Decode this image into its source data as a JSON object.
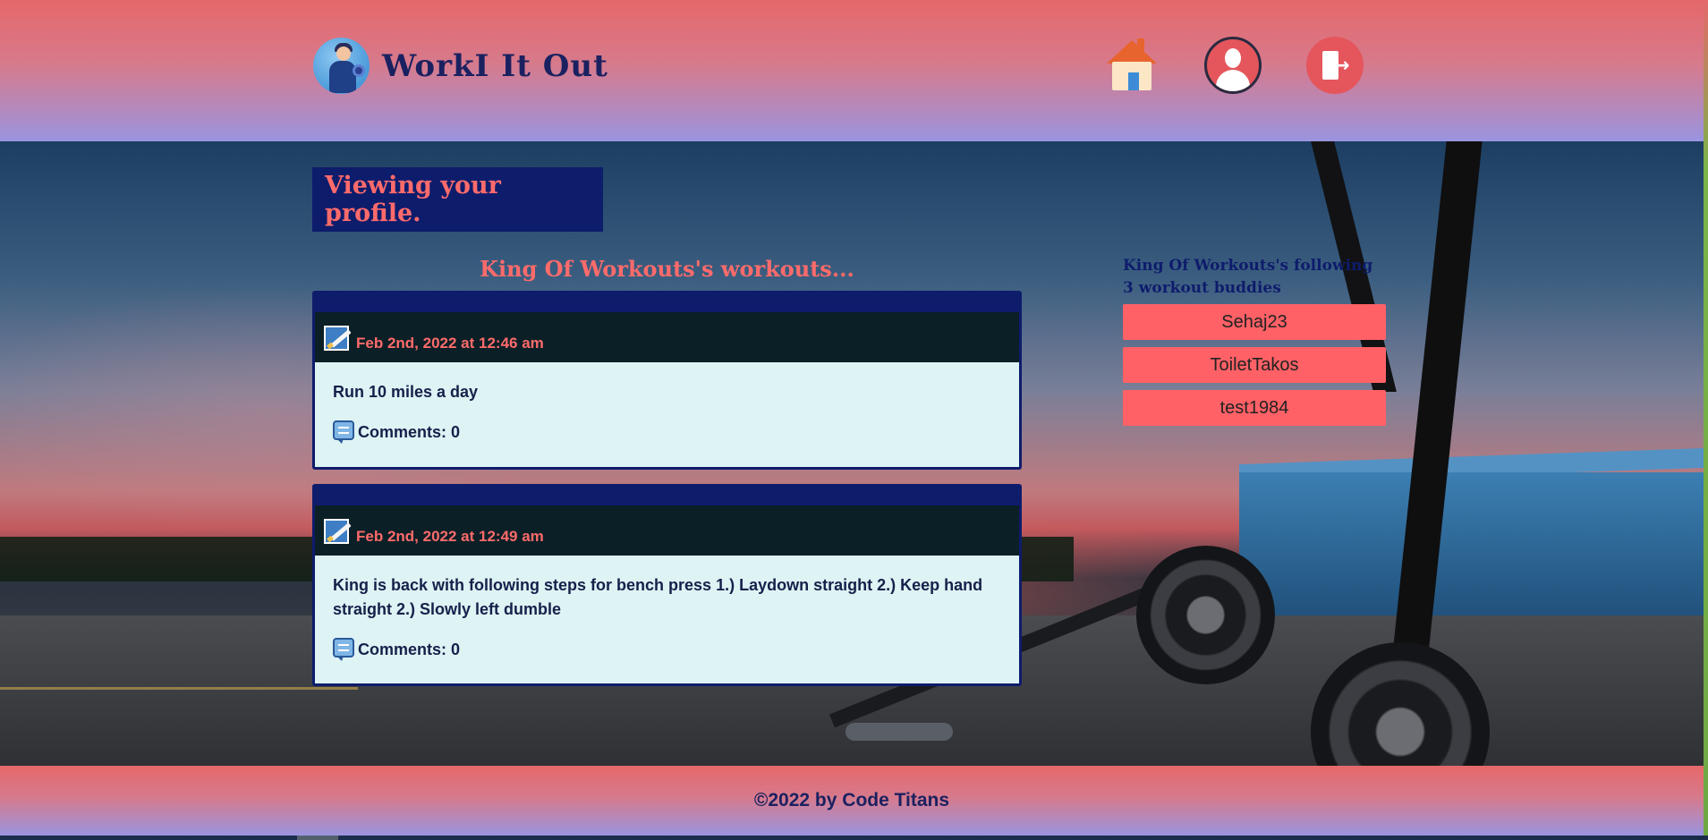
{
  "header": {
    "brand": "WorkI It Out",
    "logo_icon": "athlete-dumbbell-logo-icon",
    "nav": [
      {
        "name": "home",
        "icon": "home-icon"
      },
      {
        "name": "profile",
        "icon": "user-profile-icon"
      },
      {
        "name": "logout",
        "icon": "logout-icon"
      }
    ]
  },
  "profile": {
    "banner": "Viewing your profile.",
    "workouts_title": "King Of Workouts's workouts...",
    "workouts": [
      {
        "date": "Feb 2nd, 2022 at 12:46 am",
        "text": "Run 10 miles a day",
        "comments": "Comments: 0"
      },
      {
        "date": "Feb 2nd, 2022 at 12:49 am",
        "text": "King is back with following steps for bench press 1.) Laydown straight 2.) Keep hand straight 2.) Slowly left dumble",
        "comments": "Comments: 0"
      }
    ]
  },
  "following": {
    "title": "King Of Workouts's following 3 workout buddies",
    "buddies": [
      "Sehaj23",
      "ToiletTakos",
      "test1984"
    ]
  },
  "footer": {
    "text": "©2022 by Code Titans"
  },
  "colors": {
    "accent": "#ff6b6b",
    "navy": "#0e1c6c",
    "card_bg": "#def3f4",
    "card_head": "#0b1f26"
  }
}
